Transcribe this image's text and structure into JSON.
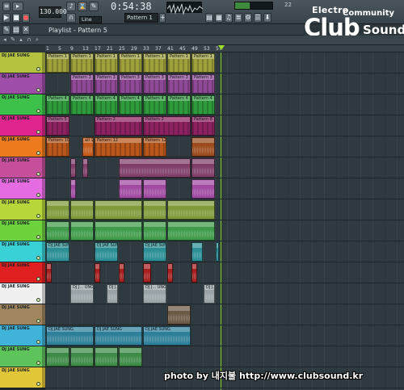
{
  "toolbar": {
    "tempo": "130.000",
    "time": "0:54:38",
    "pattern": "Pattern 1",
    "snap": "Line",
    "cpu": "22"
  },
  "logo": {
    "line1": "Electro",
    "line2": "Community",
    "line3": "Club",
    "line4": "Sound"
  },
  "playlist": {
    "title": "Playlist - Pattern 5"
  },
  "ruler": {
    "bars": [
      "1",
      "5",
      "9",
      "13",
      "17",
      "21",
      "25",
      "29",
      "33",
      "37",
      "41",
      "45",
      "49",
      "53",
      "57"
    ]
  },
  "tracks": [
    {
      "name": "DJ JAE SUNG",
      "color": "#b5c23f"
    },
    {
      "name": "DJ JAE SUNG",
      "color": "#9f4ea8"
    },
    {
      "name": "DJ JAE SUNG",
      "color": "#3ec14a"
    },
    {
      "name": "DJ JAE SUNG",
      "color": "#e0248d"
    },
    {
      "name": "DJ JAE SUNG",
      "color": "#ee7a1e"
    },
    {
      "name": "DJ JAE SUNG",
      "color": "#c64f9b"
    },
    {
      "name": "DJ JAE SUNG",
      "color": "#e46be0"
    },
    {
      "name": "DJ JAE SUNG",
      "color": "#b7d63a"
    },
    {
      "name": "DJ JAE SUNG",
      "color": "#6ed23c"
    },
    {
      "name": "DJ JAE SUNG",
      "color": "#39d0d6"
    },
    {
      "name": "DJ JAE SUNG",
      "color": "#e02020"
    },
    {
      "name": "DJ JAE SUNG",
      "color": "#f0f0f0"
    },
    {
      "name": "DJ JAE SUNG",
      "color": "#a0865e"
    },
    {
      "name": "DJ JAE SUNG",
      "color": "#3fb3d8"
    },
    {
      "name": "DJ JAE SUNG",
      "color": "#5fc35b"
    },
    {
      "name": "DJ JAE SUNG",
      "color": "#e0c638"
    }
  ],
  "clips": [
    {
      "track": 0,
      "bar": 1,
      "len": 8,
      "label": "Pattern 1",
      "kind": "pat",
      "color": "#9ea03b"
    },
    {
      "track": 0,
      "bar": 9,
      "len": 8,
      "label": "Pattern 1",
      "kind": "pat",
      "color": "#9ea03b"
    },
    {
      "track": 0,
      "bar": 17,
      "len": 8,
      "label": "Pattern 1",
      "kind": "pat",
      "color": "#9ea03b"
    },
    {
      "track": 0,
      "bar": 25,
      "len": 8,
      "label": "Pattern 1",
      "kind": "pat",
      "color": "#9ea03b"
    },
    {
      "track": 0,
      "bar": 33,
      "len": 8,
      "label": "Pattern 1",
      "kind": "pat",
      "color": "#9ea03b"
    },
    {
      "track": 0,
      "bar": 41,
      "len": 8,
      "label": "Pattern 1",
      "kind": "pat",
      "color": "#9ea03b"
    },
    {
      "track": 0,
      "bar": 49,
      "len": 8,
      "label": "Pattern 1",
      "kind": "pat",
      "color": "#9ea03b"
    },
    {
      "track": 1,
      "bar": 9,
      "len": 8,
      "label": "Pattern 3",
      "kind": "pat",
      "color": "#8e4a96"
    },
    {
      "track": 1,
      "bar": 17,
      "len": 8,
      "label": "Pattern 3",
      "kind": "pat",
      "color": "#8e4a96"
    },
    {
      "track": 1,
      "bar": 25,
      "len": 8,
      "label": "Pattern 3",
      "kind": "pat",
      "color": "#8e4a96"
    },
    {
      "track": 1,
      "bar": 33,
      "len": 8,
      "label": "Pattern 3",
      "kind": "pat",
      "color": "#8e4a96"
    },
    {
      "track": 1,
      "bar": 41,
      "len": 8,
      "label": "Pattern 3",
      "kind": "pat",
      "color": "#8e4a96"
    },
    {
      "track": 1,
      "bar": 49,
      "len": 8,
      "label": "Pattern 3",
      "kind": "pat",
      "color": "#8e4a96"
    },
    {
      "track": 2,
      "bar": 1,
      "len": 8,
      "label": "Pattern 4",
      "kind": "pat",
      "color": "#2f9b3c"
    },
    {
      "track": 2,
      "bar": 9,
      "len": 8,
      "label": "Pattern 4",
      "kind": "pat",
      "color": "#2f9b3c"
    },
    {
      "track": 2,
      "bar": 17,
      "len": 8,
      "label": "Pattern 4",
      "kind": "pat",
      "color": "#2f9b3c"
    },
    {
      "track": 2,
      "bar": 25,
      "len": 8,
      "label": "Pattern 4",
      "kind": "pat",
      "color": "#2f9b3c"
    },
    {
      "track": 2,
      "bar": 33,
      "len": 8,
      "label": "Pattern 4",
      "kind": "pat",
      "color": "#2f9b3c"
    },
    {
      "track": 2,
      "bar": 41,
      "len": 8,
      "label": "Pattern 4",
      "kind": "pat",
      "color": "#2f9b3c"
    },
    {
      "track": 2,
      "bar": 49,
      "len": 8,
      "label": "Pattern 4",
      "kind": "pat",
      "color": "#2f9b3c"
    },
    {
      "track": 3,
      "bar": 1,
      "len": 8,
      "label": "Pattern 5",
      "kind": "pat",
      "color": "#8c2260"
    },
    {
      "track": 3,
      "bar": 17,
      "len": 16,
      "label": "Pattern 2",
      "kind": "pat",
      "color": "#8c2260"
    },
    {
      "track": 3,
      "bar": 33,
      "len": 16,
      "label": "Pattern 2",
      "kind": "pat",
      "color": "#8c2260"
    },
    {
      "track": 3,
      "bar": 49,
      "len": 8,
      "label": "Pattern 8",
      "kind": "pat",
      "color": "#8c2260"
    },
    {
      "track": 4,
      "bar": 1,
      "len": 8,
      "label": "Pattern 10",
      "kind": "pat",
      "color": "#b8561c"
    },
    {
      "track": 4,
      "bar": 13,
      "len": 4,
      "label": "all 1 dies",
      "kind": "aud",
      "color": "#c25a1c"
    },
    {
      "track": 4,
      "bar": 17,
      "len": 16,
      "label": "Pattern 12",
      "kind": "pat",
      "color": "#b8561c"
    },
    {
      "track": 4,
      "bar": 33,
      "len": 8,
      "label": "Pattern 12",
      "kind": "pat",
      "color": "#b8561c"
    },
    {
      "track": 4,
      "bar": 49,
      "len": 8,
      "label": "",
      "kind": "aud",
      "color": "#9a4b1e"
    },
    {
      "track": 5,
      "bar": 9,
      "len": 2,
      "label": "",
      "kind": "aud",
      "color": "#7e3e68"
    },
    {
      "track": 5,
      "bar": 13,
      "len": 2,
      "label": "",
      "kind": "aud",
      "color": "#7e3e68"
    },
    {
      "track": 5,
      "bar": 25,
      "len": 24,
      "label": "",
      "kind": "aud",
      "color": "#7e3e68"
    },
    {
      "track": 5,
      "bar": 49,
      "len": 8,
      "label": "",
      "kind": "aud",
      "color": "#7e3e68"
    },
    {
      "track": 6,
      "bar": 9,
      "len": 2,
      "label": "",
      "kind": "aud",
      "color": "#a04aa0"
    },
    {
      "track": 6,
      "bar": 25,
      "len": 8,
      "label": "",
      "kind": "aud",
      "color": "#a04aa0"
    },
    {
      "track": 6,
      "bar": 33,
      "len": 8,
      "label": "",
      "kind": "aud",
      "color": "#a04aa0"
    },
    {
      "track": 6,
      "bar": 49,
      "len": 8,
      "label": "",
      "kind": "aud",
      "color": "#a04aa0"
    },
    {
      "track": 7,
      "bar": 1,
      "len": 8,
      "label": "",
      "kind": "aud",
      "color": "#7f9a3a"
    },
    {
      "track": 7,
      "bar": 9,
      "len": 8,
      "label": "",
      "kind": "aud",
      "color": "#7f9a3a"
    },
    {
      "track": 7,
      "bar": 17,
      "len": 16,
      "label": "",
      "kind": "aud",
      "color": "#7f9a3a"
    },
    {
      "track": 7,
      "bar": 33,
      "len": 8,
      "label": "",
      "kind": "aud",
      "color": "#7f9a3a"
    },
    {
      "track": 7,
      "bar": 41,
      "len": 16,
      "label": "",
      "kind": "aud",
      "color": "#7f9a3a"
    },
    {
      "track": 8,
      "bar": 1,
      "len": 8,
      "label": "",
      "kind": "aud",
      "color": "#3f9a4a"
    },
    {
      "track": 8,
      "bar": 9,
      "len": 8,
      "label": "",
      "kind": "aud",
      "color": "#3f9a4a"
    },
    {
      "track": 8,
      "bar": 17,
      "len": 16,
      "label": "",
      "kind": "aud",
      "color": "#3f9a4a"
    },
    {
      "track": 8,
      "bar": 33,
      "len": 8,
      "label": "",
      "kind": "aud",
      "color": "#3f9a4a"
    },
    {
      "track": 8,
      "bar": 41,
      "len": 16,
      "label": "",
      "kind": "aud",
      "color": "#3f9a4a"
    },
    {
      "track": 9,
      "bar": 1,
      "len": 8,
      "label": "DJ JAE SUNG",
      "kind": "aud",
      "color": "#2d8f96"
    },
    {
      "track": 9,
      "bar": 17,
      "len": 8,
      "label": "DJ JAE SUNG",
      "kind": "aud",
      "color": "#2d8f96"
    },
    {
      "track": 9,
      "bar": 33,
      "len": 8,
      "label": "DJ JAE SUNG",
      "kind": "aud",
      "color": "#2d8f96"
    },
    {
      "track": 9,
      "bar": 49,
      "len": 4,
      "label": "",
      "kind": "aud",
      "color": "#2d8f96"
    },
    {
      "track": 9,
      "bar": 57,
      "len": 1,
      "label": "",
      "kind": "aud",
      "color": "#2d8f96"
    },
    {
      "track": 10,
      "bar": 1,
      "len": 2,
      "label": "",
      "kind": "aud",
      "color": "#a62020"
    },
    {
      "track": 10,
      "bar": 17,
      "len": 2,
      "label": "",
      "kind": "aud",
      "color": "#a62020"
    },
    {
      "track": 10,
      "bar": 25,
      "len": 2,
      "label": "",
      "kind": "aud",
      "color": "#a62020"
    },
    {
      "track": 10,
      "bar": 33,
      "len": 3,
      "label": "",
      "kind": "aud",
      "color": "#a62020"
    },
    {
      "track": 10,
      "bar": 41,
      "len": 2,
      "label": "",
      "kind": "aud",
      "color": "#a62020"
    },
    {
      "track": 10,
      "bar": 49,
      "len": 2,
      "label": "",
      "kind": "aud",
      "color": "#a62020"
    },
    {
      "track": 11,
      "bar": 9,
      "len": 8,
      "label": "DJ J... UNG",
      "kind": "aud",
      "color": "#9aa4a8"
    },
    {
      "track": 11,
      "bar": 21,
      "len": 4,
      "label": "DJ J... UNG",
      "kind": "aud",
      "color": "#9aa4a8"
    },
    {
      "track": 11,
      "bar": 33,
      "len": 8,
      "label": "DJ J... UNG",
      "kind": "aud",
      "color": "#9aa4a8"
    },
    {
      "track": 11,
      "bar": 53,
      "len": 4,
      "label": "DJ J... UNG",
      "kind": "aud",
      "color": "#9aa4a8"
    },
    {
      "track": 12,
      "bar": 41,
      "len": 8,
      "label": "",
      "kind": "aud",
      "color": "#6a5a45"
    },
    {
      "track": 13,
      "bar": 1,
      "len": 16,
      "label": "DJ JAE SUNG",
      "kind": "aud",
      "color": "#2d7f9a"
    },
    {
      "track": 13,
      "bar": 17,
      "len": 16,
      "label": "DJ JAE SUNG",
      "kind": "aud",
      "color": "#2d7f9a"
    },
    {
      "track": 13,
      "bar": 33,
      "len": 16,
      "label": "DJ JAE SUNG",
      "kind": "aud",
      "color": "#2d7f9a"
    },
    {
      "track": 14,
      "bar": 1,
      "len": 8,
      "label": "",
      "kind": "aud",
      "color": "#3d8a46"
    },
    {
      "track": 14,
      "bar": 9,
      "len": 8,
      "label": "",
      "kind": "aud",
      "color": "#3d8a46"
    },
    {
      "track": 14,
      "bar": 17,
      "len": 8,
      "label": "",
      "kind": "aud",
      "color": "#3d8a46"
    },
    {
      "track": 14,
      "bar": 25,
      "len": 8,
      "label": "",
      "kind": "aud",
      "color": "#3d8a46"
    }
  ],
  "credit": "photo by 내지불 http://www.clubsound.kr"
}
